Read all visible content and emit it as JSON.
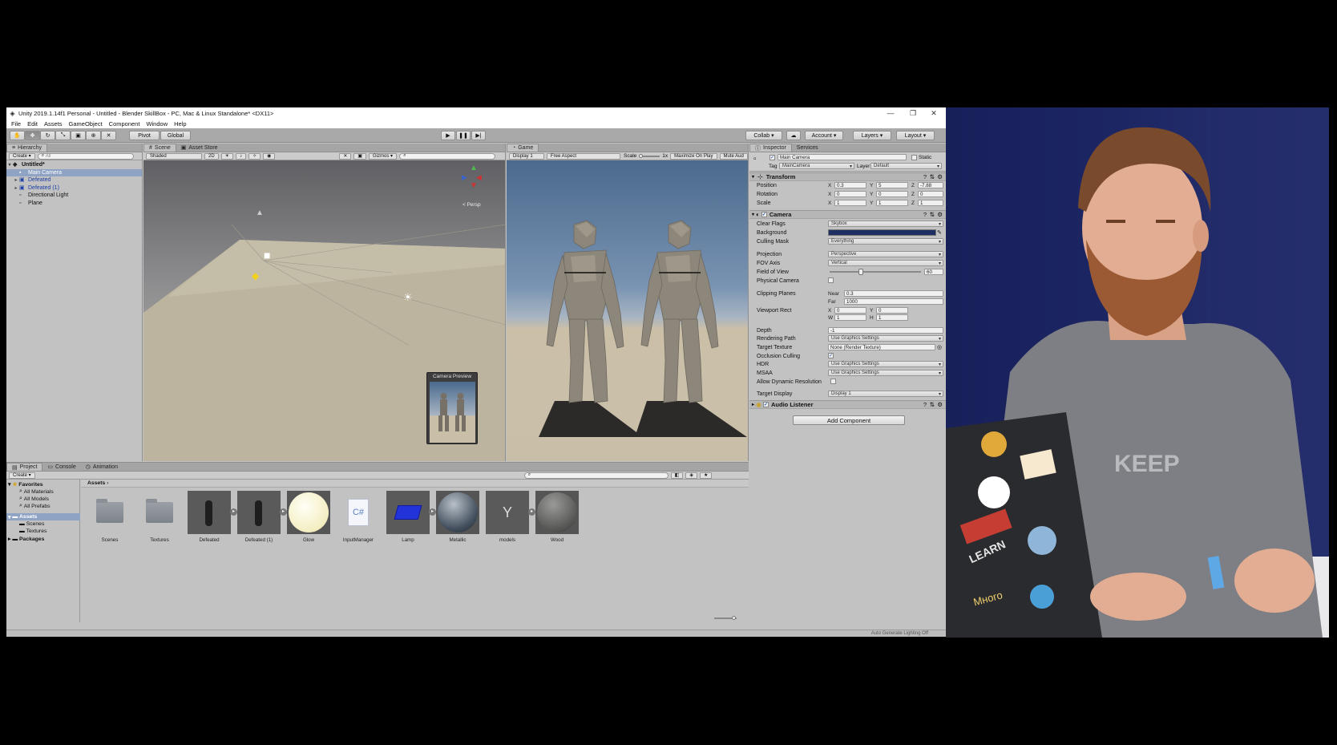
{
  "window": {
    "title": "Unity 2019.1.14f1 Personal - Untitled - Blender SkillBox - PC, Mac & Linux Standalone* <DX11>",
    "controls": [
      "—",
      "❐",
      "✕"
    ]
  },
  "menu": [
    "File",
    "Edit",
    "Assets",
    "GameObject",
    "Component",
    "Window",
    "Help"
  ],
  "toolbar": {
    "pivot": "Pivot",
    "global": "Global",
    "collab": "Collab ▾",
    "account": "Account",
    "layers": "Layers",
    "layout": "Layout"
  },
  "hierarchy": {
    "tab": "Hierarchy",
    "create": "Create",
    "search_placeholder": "All",
    "scene": "Untitled*",
    "items": [
      {
        "label": "Main Camera",
        "selected": true
      },
      {
        "label": "Defeated"
      },
      {
        "label": "Defeated (1)"
      },
      {
        "label": "Directional Light"
      },
      {
        "label": "Plane"
      }
    ]
  },
  "scene": {
    "tabs": [
      "Scene",
      "Asset Store"
    ],
    "shading": "Shaded",
    "mode_2d": "2D",
    "gizmos": "Gizmos",
    "persp": "< Persp",
    "camera_preview": "Camera Preview"
  },
  "game": {
    "tab": "Game",
    "display": "Display 1",
    "aspect": "Free Aspect",
    "scale_label": "Scale",
    "scale_value": "1x",
    "maximize": "Maximize On Play",
    "mute": "Mute Aud"
  },
  "inspector": {
    "tabs": [
      "Inspector",
      "Services"
    ],
    "object_name": "Main Camera",
    "static": "Static",
    "tag_label": "Tag",
    "tag": "MainCamera",
    "layer_label": "Layer",
    "layer": "Default",
    "transform": {
      "title": "Transform",
      "position_label": "Position",
      "rotation_label": "Rotation",
      "scale_label": "Scale",
      "position": [
        "0.3",
        "5",
        "-7.88"
      ],
      "rotation": [
        "0",
        "0",
        "0"
      ],
      "scale": [
        "1",
        "1",
        "1"
      ]
    },
    "camera": {
      "title": "Camera",
      "clear_flags_label": "Clear Flags",
      "clear_flags": "Skybox",
      "background_label": "Background",
      "background_color": "#1d2f63",
      "culling_mask_label": "Culling Mask",
      "culling_mask": "Everything",
      "projection_label": "Projection",
      "projection": "Perspective",
      "fov_axis_label": "FOV Axis",
      "fov_axis": "Vertical",
      "fov_label": "Field of View",
      "fov": "60",
      "fov_fraction": 0.333,
      "physical_label": "Physical Camera",
      "clipping_label": "Clipping Planes",
      "near_label": "Near",
      "near": "0.3",
      "far_label": "Far",
      "far": "1000",
      "viewport_label": "Viewport Rect",
      "viewport": {
        "x": "0",
        "y": "0",
        "w": "1",
        "h": "1"
      },
      "depth_label": "Depth",
      "depth": "-1",
      "rendering_path_label": "Rendering Path",
      "rendering_path": "Use Graphics Settings",
      "target_texture_label": "Target Texture",
      "target_texture": "None (Render Texture)",
      "occlusion_label": "Occlusion Culling",
      "hdr_label": "HDR",
      "hdr": "Use Graphics Settings",
      "msaa_label": "MSAA",
      "msaa": "Use Graphics Settings",
      "dynres_label": "Allow Dynamic Resolution",
      "target_display_label": "Target Display",
      "target_display": "Display 1"
    },
    "audio_listener": "Audio Listener",
    "add_component": "Add Component"
  },
  "project": {
    "tabs": [
      "Project",
      "Console",
      "Animation"
    ],
    "create": "Create",
    "favorites": "Favorites",
    "fav_items": [
      "All Materials",
      "All Models",
      "All Prefabs"
    ],
    "assets_root": "Assets",
    "asset_folders": [
      "Scenes",
      "Textures"
    ],
    "packages": "Packages",
    "breadcrumb": "Assets",
    "assets": [
      {
        "label": "Scenes",
        "kind": "folder"
      },
      {
        "label": "Textures",
        "kind": "folder"
      },
      {
        "label": "Defeated",
        "kind": "model"
      },
      {
        "label": "Defeated (1)",
        "kind": "model"
      },
      {
        "label": "Glow",
        "kind": "glow"
      },
      {
        "label": "InputManager",
        "kind": "script"
      },
      {
        "label": "Lamp",
        "kind": "lamp"
      },
      {
        "label": "Metallic",
        "kind": "metal"
      },
      {
        "label": "models",
        "kind": "models"
      },
      {
        "label": "Wood",
        "kind": "wood"
      }
    ],
    "status": "Auto Generate Lighting Off"
  },
  "webcam": {
    "shirt_text": "KEEP",
    "sticker_texts": [
      "LEARN",
      "Много"
    ]
  }
}
